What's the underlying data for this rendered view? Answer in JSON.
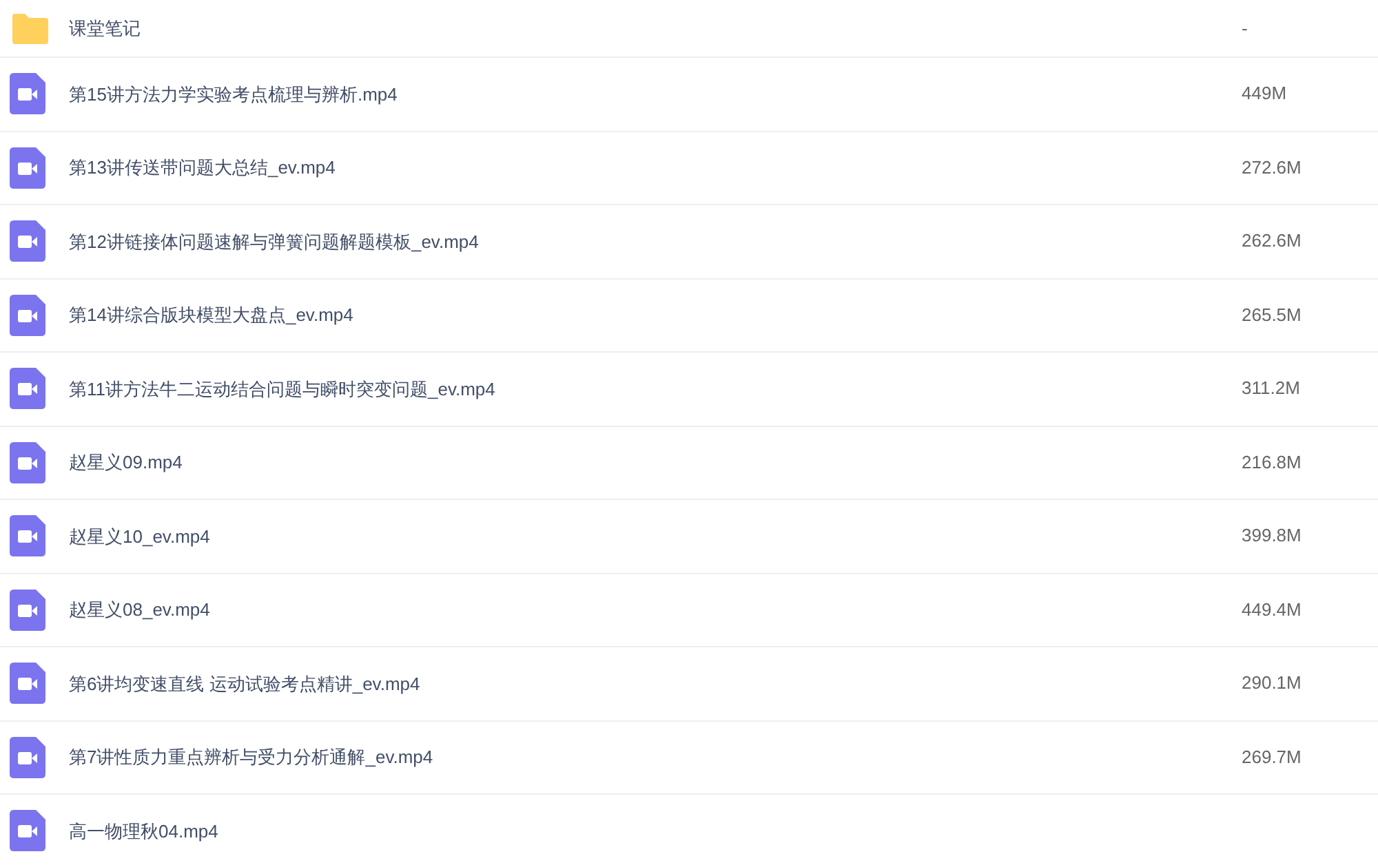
{
  "files": [
    {
      "kind": "folder",
      "name": "课堂笔记",
      "size": "-"
    },
    {
      "kind": "video",
      "name": "第15讲方法力学实验考点梳理与辨析.mp4",
      "size": "449M"
    },
    {
      "kind": "video",
      "name": "第13讲传送带问题大总结_ev.mp4",
      "size": "272.6M"
    },
    {
      "kind": "video",
      "name": "第12讲链接体问题速解与弹簧问题解题模板_ev.mp4",
      "size": "262.6M"
    },
    {
      "kind": "video",
      "name": "第14讲综合版块模型大盘点_ev.mp4",
      "size": "265.5M"
    },
    {
      "kind": "video",
      "name": "第11讲方法牛二运动结合问题与瞬时突变问题_ev.mp4",
      "size": "311.2M"
    },
    {
      "kind": "video",
      "name": "赵星义09.mp4",
      "size": "216.8M"
    },
    {
      "kind": "video",
      "name": "赵星义10_ev.mp4",
      "size": "399.8M"
    },
    {
      "kind": "video",
      "name": "赵星义08_ev.mp4",
      "size": "449.4M"
    },
    {
      "kind": "video",
      "name": "第6讲均变速直线 运动试验考点精讲_ev.mp4",
      "size": "290.1M"
    },
    {
      "kind": "video",
      "name": "第7讲性质力重点辨析与受力分析通解_ev.mp4",
      "size": "269.7M"
    },
    {
      "kind": "video",
      "name": "高一物理秋04.mp4"
    }
  ]
}
